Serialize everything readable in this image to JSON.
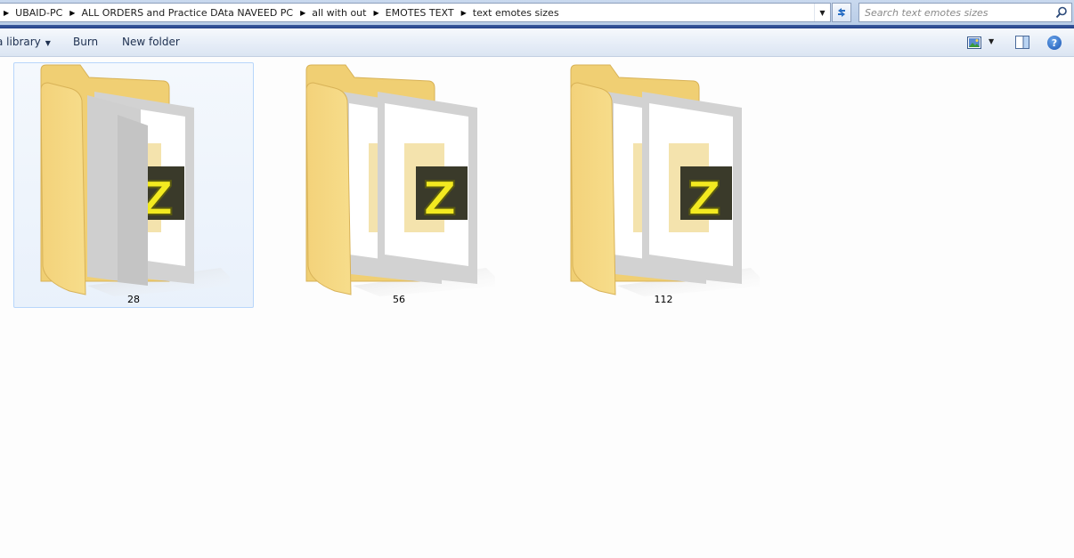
{
  "address_bar": {
    "crumbs": [
      "UBAID-PC",
      "ALL ORDERS and Practice DAta NAVEED PC",
      "all with out",
      "EMOTES TEXT",
      "text emotes sizes"
    ]
  },
  "search": {
    "placeholder": "Search text emotes sizes"
  },
  "toolbar": {
    "library_label": "a library",
    "burn_label": "Burn",
    "new_folder_label": "New folder"
  },
  "folders": [
    {
      "name": "28",
      "selected": true
    },
    {
      "name": "56",
      "selected": false
    },
    {
      "name": "112",
      "selected": false
    }
  ],
  "colors": {
    "folder_front": "#f7dd8b",
    "folder_back": "#f0cf73",
    "selection_border": "#b8d6fb",
    "selection_fill": "#eaf2fc"
  }
}
